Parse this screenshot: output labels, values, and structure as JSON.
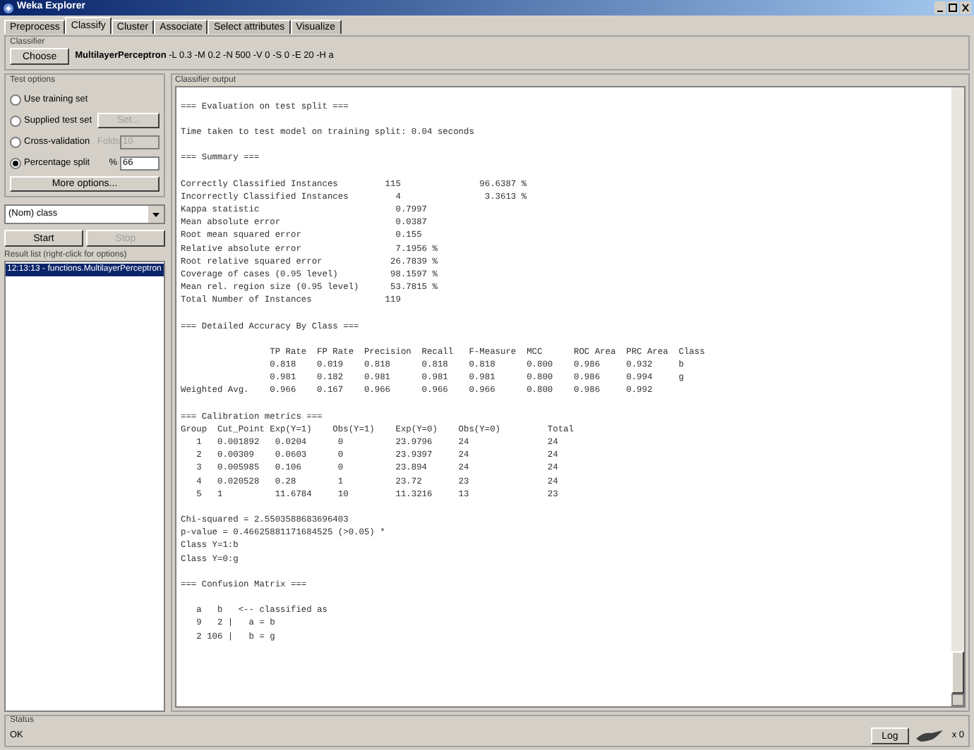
{
  "window": {
    "title": "Weka Explorer"
  },
  "tabs": [
    {
      "label": "Preprocess",
      "selected": false
    },
    {
      "label": "Classify",
      "selected": true
    },
    {
      "label": "Cluster",
      "selected": false
    },
    {
      "label": "Associate",
      "selected": false
    },
    {
      "label": "Select attributes",
      "selected": false
    },
    {
      "label": "Visualize",
      "selected": false
    }
  ],
  "classifier": {
    "title": "Classifier",
    "choose_button": "Choose",
    "spec": "**MultilayerPerceptron** -L 0.3 -M 0.2 -N 500 -V 0 -S 0 -E 20 -H a"
  },
  "test_options": {
    "title": "Test options",
    "options": [
      {
        "label": "Use training set",
        "selected": false
      },
      {
        "label": "Supplied test set",
        "selected": false,
        "button": {
          "label": "Set...",
          "disabled": true
        }
      },
      {
        "label": "Cross-validation",
        "selected": false,
        "field": {
          "label": "Folds",
          "value": "10",
          "disabled": true
        }
      },
      {
        "label": "Percentage split",
        "selected": true,
        "field": {
          "label": "%",
          "value": "66",
          "disabled": false
        }
      }
    ],
    "more_button": "More options..."
  },
  "class_select": {
    "value": "(Nom) class"
  },
  "start_button": {
    "label": "Start",
    "disabled": false
  },
  "stop_button": {
    "label": "Stop",
    "disabled": true
  },
  "result_list": {
    "title": "Result list (right-click for options)",
    "items": [
      {
        "label": "12:13:13 - functions.MultilayerPerceptron",
        "selected": true
      }
    ]
  },
  "output": {
    "title": "Classifier output",
    "sections": [
      [
        "=== Evaluation on test split ==="
      ],
      [
        "Time taken to test model on training split: 0.04 seconds"
      ],
      [
        "=== Summary ==="
      ],
      [
        "Correctly Classified Instances         115               96.6387 %",
        "Incorrectly Classified Instances         4                3.3613 %",
        "Kappa statistic                          0.7997",
        "Mean absolute error                      0.0387",
        "Root mean squared error                  0.155",
        "Relative absolute error                  7.1956 %",
        "Root relative squared error             26.7839 %",
        "Coverage of cases (0.95 level)          98.1597 %",
        "Mean rel. region size (0.95 level)      53.7815 %",
        "Total Number of Instances              119"
      ],
      [
        "=== Detailed Accuracy By Class ==="
      ],
      [
        "                 TP Rate  FP Rate  Precision  Recall   F-Measure  MCC      ROC Area  PRC Area  Class",
        "                 0.818    0.019    0.818      0.818    0.818      0.800    0.986     0.932     b",
        "                 0.981    0.182    0.981      0.981    0.981      0.800    0.986     0.994     g",
        "Weighted Avg.    0.966    0.167    0.966      0.966    0.966      0.800    0.986     0.992"
      ],
      [
        "=== Calibration metrics ===",
        "Group  Cut_Point Exp(Y=1)    Obs(Y=1)    Exp(Y=0)    Obs(Y=0)         Total",
        "   1   0.001892   0.0204      0          23.9796     24               24",
        "   2   0.00309    0.0603      0          23.9397     24               24",
        "   3   0.005985   0.106       0          23.894      24               24",
        "   4   0.020528   0.28        1          23.72       23               24",
        "   5   1          11.6784     10         11.3216     13               23"
      ],
      [
        "Chi-squared = 2.5503588683696403",
        "p-value = 0.46625881171684525 (>0.05) *",
        "Class Y=1:b",
        "Class Y=0:g"
      ],
      [
        "=== Confusion Matrix ==="
      ],
      [
        "   a   b   <-- classified as",
        "   9   2 |   a = b",
        "   2 106 |   b = g"
      ]
    ]
  },
  "status": {
    "title": "Status",
    "message": "OK",
    "log_button": "Log",
    "count": "x 0"
  }
}
